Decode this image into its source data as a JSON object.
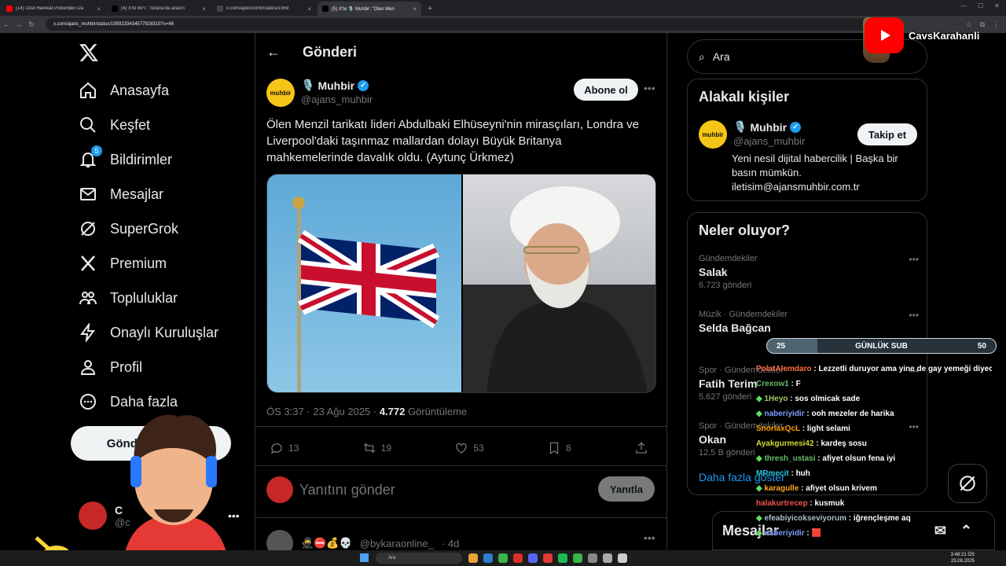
{
  "browser": {
    "tabs": [
      {
        "title": "(14) Özel Harekat Polisinden Da",
        "fav": "#ff0000",
        "active": false
      },
      {
        "title": "(4) X'te BPT: \"Adana'da aracın",
        "fav": "#000000",
        "active": false
      },
      {
        "title": "x.com/aykiricomtr/status/1959",
        "fav": "#444444",
        "active": false
      },
      {
        "title": "(5) X'te 🎙️ Muhbir: \"Ölen Men",
        "fav": "#000000",
        "active": true
      }
    ],
    "url": "x.com/ajans_muhbir/status/1959233434577928315?s=46"
  },
  "nav": {
    "items": [
      {
        "label": "Anasayfa",
        "icon": "home-icon"
      },
      {
        "label": "Keşfet",
        "icon": "search-icon"
      },
      {
        "label": "Bildirimler",
        "icon": "bell-icon",
        "badge": "5"
      },
      {
        "label": "Mesajlar",
        "icon": "mail-icon"
      },
      {
        "label": "SuperGrok",
        "icon": "grok-icon"
      },
      {
        "label": "Premium",
        "icon": "x-icon"
      },
      {
        "label": "Topluluklar",
        "icon": "communities-icon"
      },
      {
        "label": "Onaylı Kuruluşlar",
        "icon": "lightning-icon"
      },
      {
        "label": "Profil",
        "icon": "person-icon"
      },
      {
        "label": "Daha fazla",
        "icon": "more-circle-icon"
      }
    ],
    "post_button": "Gönderi yayınla",
    "account_name": "C",
    "account_handle": "@c"
  },
  "header": {
    "title": "Gönderi"
  },
  "post": {
    "author_emoji": "🎙️",
    "author": "Muhbir",
    "handle": "@ajans_muhbir",
    "avatar_text": "muhbir",
    "subscribe": "Abone ol",
    "text": "Ölen Menzil tarikatı lideri Abdulbaki Elhüseyni'nin mirasçıları, Londra ve Liverpool'daki taşınmaz mallardan dolayı Büyük Britanya mahkemelerinde davalık oldu. (Aytunç Ürkmez)",
    "time": "ÖS 3:37 · 23 Ağu 2025 · ",
    "views": "4.772",
    "views_label": " Görüntüleme",
    "replies": "13",
    "reposts": "19",
    "likes": "53",
    "bookmarks": "8"
  },
  "reply": {
    "placeholder": "Yanıtını gönder",
    "button": "Yanıtla"
  },
  "next_post": {
    "emojis": "🥷⛔💰💀",
    "handle": "@bykaraonline_",
    "time": "· 4d"
  },
  "search": {
    "placeholder": "Ara"
  },
  "related": {
    "title": "Alakalı kişiler",
    "emoji": "🎙️",
    "name": "Muhbir",
    "handle": "@ajans_muhbir",
    "follow": "Takip et",
    "bio": "Yeni nesil dijital habercilik | Başka bir basın mümkün. iletisim@ajansmuhbir.com.tr"
  },
  "trends": {
    "title": "Neler oluyor?",
    "items": [
      {
        "category": "Gündemdekiler",
        "name": "Salak",
        "count": "6.723 gönderi"
      },
      {
        "category": "Müzik · Gündemdekiler",
        "name": "Selda Bağcan",
        "count": ""
      },
      {
        "category": "Spor · Gündemdekiler",
        "name": "Fatih Terim",
        "count": "5.627 gönderi"
      },
      {
        "category": "Spor · Gündemdekiler",
        "name": "Okan",
        "count": "12,5 B gönderi"
      }
    ],
    "show_more": "Daha fazla göster"
  },
  "messages": {
    "label": "Mesajlar"
  },
  "overlay": {
    "channel": "CavsKarahanli",
    "sub_goal_left": "25",
    "sub_goal_label": "GÜNLÜK SUB",
    "sub_goal_right": "50",
    "sub_progress": 0.22,
    "chat": [
      {
        "user": "PolatAlemdaro",
        "color": "#ff7043",
        "msg": "Lezzetli duruyor ama yine de gay yemeği diyecm",
        "gem": false
      },
      {
        "user": "Crexow1",
        "color": "#66bb6a",
        "msg": "F",
        "gem": false
      },
      {
        "user": "1Heyo",
        "color": "#9ccc65",
        "msg": "sos olmicak sade",
        "gem": true
      },
      {
        "user": "naberiyidir",
        "color": "#7e9cff",
        "msg": "ooh mezeler de harika",
        "gem": true
      },
      {
        "user": "SnorlaxQcL",
        "color": "#ff9800",
        "msg": "light selami",
        "gem": false
      },
      {
        "user": "Ayakgurmesi42",
        "color": "#cddc39",
        "msg": "kardeş sosu",
        "gem": false
      },
      {
        "user": "thresh_ustasi",
        "color": "#66bb6a",
        "msg": "afiyet olsun fena iyi",
        "gem": true
      },
      {
        "user": "MRmecit",
        "color": "#26c6da",
        "msg": "huh",
        "gem": false
      },
      {
        "user": "karagulle",
        "color": "#ffa726",
        "msg": "afiyet olsun krivem",
        "gem": true
      },
      {
        "user": "halakurtrecep",
        "color": "#ef5350",
        "msg": "kusmuk",
        "gem": false
      },
      {
        "user": "efeabiyicokseviyorum",
        "color": "#b0bec5",
        "msg": "iğrençleşme aq",
        "gem": true
      },
      {
        "user": "naberiyidir",
        "color": "#7e9cff",
        "msg": "🟥",
        "gem": true
      }
    ]
  },
  "taskbar": {
    "search": "Ara",
    "time": "3:48:21 ÖS",
    "date": "23.08.2025"
  }
}
